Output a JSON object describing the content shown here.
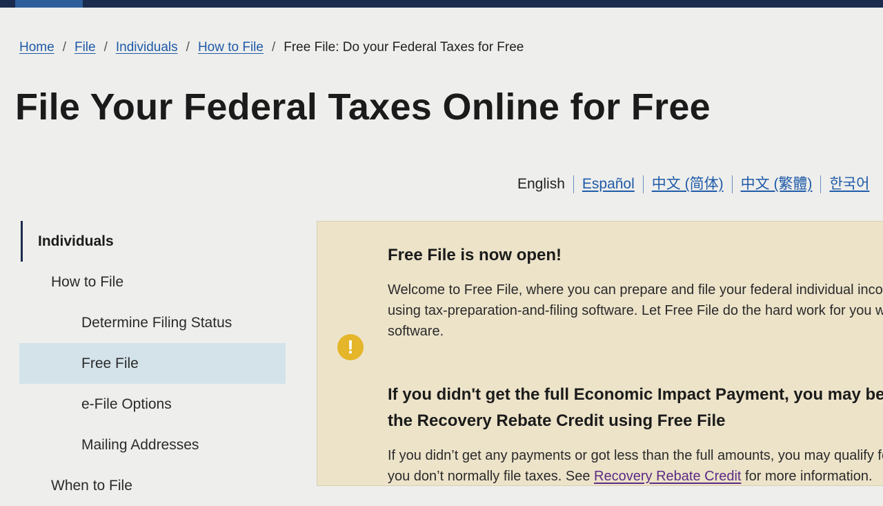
{
  "breadcrumb": {
    "items": [
      "Home",
      "File",
      "Individuals",
      "How to File"
    ],
    "separator": "/",
    "current": "Free File: Do your Federal Taxes for Free"
  },
  "page": {
    "title": "File Your Federal Taxes Online for Free"
  },
  "languages": {
    "active": "English",
    "links": [
      "Español",
      "中文 (简体)",
      "中文 (繁體)",
      "한국어"
    ]
  },
  "sidenav": {
    "items": [
      {
        "label": "Individuals"
      },
      {
        "label": "How to File"
      },
      {
        "label": "Determine Filing Status"
      },
      {
        "label": "Free File"
      },
      {
        "label": "e-File Options"
      },
      {
        "label": "Mailing Addresses"
      },
      {
        "label": "When to File"
      }
    ]
  },
  "alert": {
    "icon": "exclamation-icon",
    "heading1": "Free File is now open!",
    "para1_line1": "Welcome to Free File, where you can prepare and file your federal individual income tax return for free",
    "para1_line2": "using tax-preparation-and-filing software. Let Free File do the hard work for you with brand-name",
    "para1_line3": "software.",
    "heading2_line1": "If you didn't get the full Economic Impact Payment, you may be eligible to claim",
    "heading2_line2": "the Recovery Rebate Credit using Free File",
    "para2_line1": "If you didn’t get any payments or got less than the full amounts, you may qualify for the credit even if",
    "para2_line2_prefix": "you don’t normally file taxes. See ",
    "para2_link": "Recovery Rebate Credit",
    "para2_line2_suffix": " for more information."
  },
  "colors": {
    "topbar": "#1a2b4d",
    "link": "#1e5aa8",
    "alert_bg": "#ece3c9",
    "alert_icon": "#e5b52a",
    "nav_selected": "#d4e3ea",
    "visited_link": "#5b2a86"
  }
}
